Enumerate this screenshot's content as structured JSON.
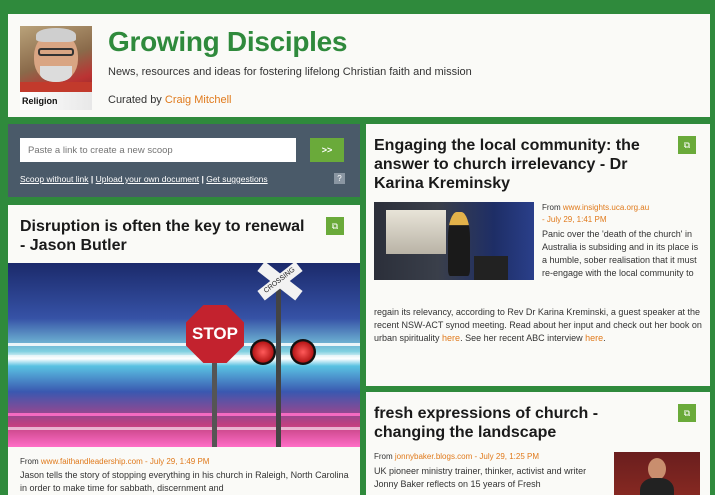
{
  "header": {
    "title": "Growing Disciples",
    "subtitle": "News, resources and ideas for fostering lifelong Christian faith and mission",
    "curated_prefix": "Curated by",
    "curator": "Craig Mitchell",
    "avatar_label": "Religion"
  },
  "scoop": {
    "placeholder": "Paste a link to create a new scoop",
    "go_label": ">>",
    "links": [
      "Scoop without link",
      "Upload your own document",
      "Get suggestions"
    ],
    "separator": " | ",
    "help": "?"
  },
  "posts": [
    {
      "title": "Disruption is often the key to renewal - Jason Butler",
      "from_label": "From",
      "source": "www.faithandleadership.com",
      "date": "July 29, 1:49 PM",
      "body": "Jason tells the story of stopping everything in his church in Raleigh, North Carolina in order to make time for sabbath, discernment and",
      "image_sign_text": "STOP",
      "image_crossing_text": "CROSSING"
    },
    {
      "title": "Engaging the local community: the answer to church irrelevancy - Dr Karina Kreminsky",
      "from_label": "From",
      "source": "www.insights.uca.org.au",
      "date": "July 29, 1:41 PM",
      "body_p1": "Panic over the 'death of the church' in Australia is subsiding and in its place is a humble, sober realisation that it must re-engage with the local community to",
      "body_p2": "regain its relevancy, according to Rev Dr Karina Kreminski, a guest speaker at the recent NSW-ACT synod meeting. Read about her input and check out her book on urban spirituality",
      "link1": "here",
      "body_p3": ". See her recent ABC interview",
      "link2": "here",
      "body_end": "."
    },
    {
      "title": "fresh expressions of church - changing the landscape",
      "from_label": "From",
      "source": "jonnybaker.blogs.com",
      "date": "July 29, 1:25 PM",
      "body": "UK pioneer ministry trainer, thinker, activist and writer Jonny Baker reflects on 15 years of Fresh"
    }
  ],
  "rescoop_icon": "rescoop-icon",
  "colors": {
    "brand_green": "#2f8a3c",
    "accent_orange": "#e07a1c",
    "panel": "#4a5a69"
  }
}
